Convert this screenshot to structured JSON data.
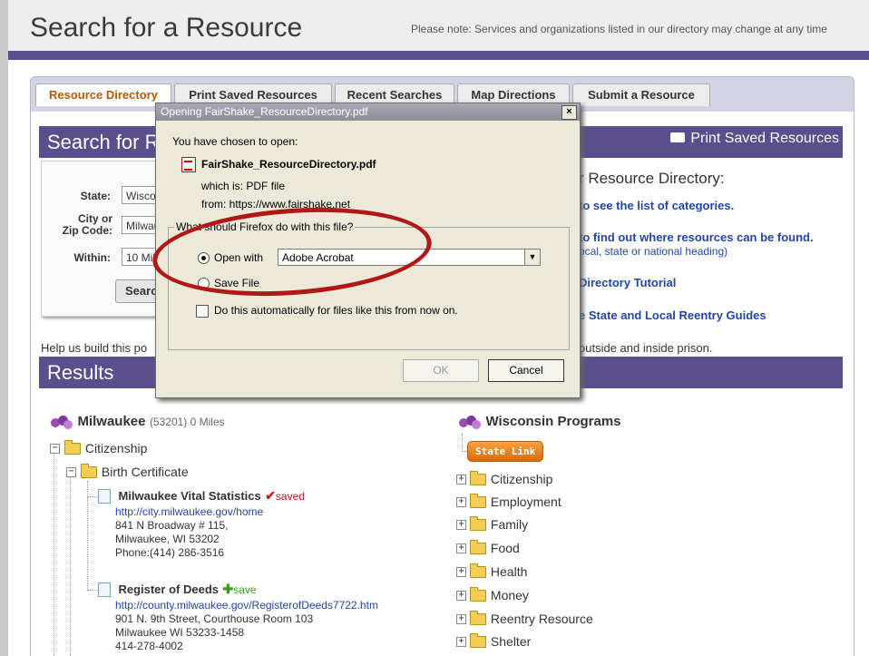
{
  "page": {
    "title": "Search for a Resource",
    "notice": "Please note: Services and organizations listed in our directory may change at any time"
  },
  "tabs": [
    "Resource Directory",
    "Print Saved Resources",
    "Recent Searches",
    "Map Directions",
    "Submit a Resource"
  ],
  "search_section": {
    "header": "Search for R",
    "print_saved": "Print Saved Resources",
    "state_label": "State:",
    "state_value": "Wisconsin",
    "city_label_1": "City or",
    "city_label_2": "Zip Code:",
    "city_value": "Milwaukee",
    "within_label": "Within:",
    "within_value": "10 Miles",
    "search_button": "Search"
  },
  "directory_help": {
    "heading": "r Resource Directory:",
    "link1": "to see the list of categories.",
    "link2": "to find out where resources can be found.",
    "link2_sub": "ocal, state or national heading)",
    "link3": "Directory Tutorial",
    "link4": "e State and Local Reentry Guides"
  },
  "help_line_left": "Help us build this po",
  "help_line_right": "outside and inside prison.",
  "results": {
    "header": "Results",
    "left": {
      "location": "Milwaukee",
      "location_meta": "(53201) 0 Miles",
      "category": "Citizenship",
      "subcategory": "Birth Certificate",
      "items": [
        {
          "name": "Milwaukee Vital Statistics",
          "status": "saved",
          "url": "http://city.milwaukee.gov/home",
          "address1": "841 N Broadway # 115,",
          "address2": "Milwaukee, WI 53202",
          "phone": "Phone:(414) 286-3516"
        },
        {
          "name": "Register of Deeds",
          "status": "save",
          "url": "http://county.milwaukee.gov/RegisterofDeeds7722.htm",
          "address1": "901 N. 9th Street, Courthouse Room 103",
          "address2": "Milwaukee WI 53233-1458",
          "phone": "414-278-4002"
        }
      ]
    },
    "right": {
      "title": "Wisconsin Programs",
      "state_link": "State Link",
      "categories": [
        "Citizenship",
        "Employment",
        "Family",
        "Food",
        "Health",
        "Money",
        "Reentry Resource",
        "Shelter"
      ]
    }
  },
  "dialog": {
    "title": "Opening FairShake_ResourceDirectory.pdf",
    "close": "×",
    "intro": "You have chosen to open:",
    "filename": "FairShake_ResourceDirectory.pdf",
    "which_is": "which is:  PDF file",
    "from": "from:  https://www.fairshake.net",
    "group_label": "What should Firefox do with this file?",
    "open_with_label": "Open with",
    "open_with_value": "Adobe Acrobat",
    "save_file_label": "Save File",
    "auto_label": "Do this automatically for files like this from now on.",
    "ok": "OK",
    "cancel": "Cancel"
  },
  "colors": {
    "brand_purple": "#5b4e8c",
    "link_blue": "#2346a0",
    "active_tab_text": "#b35a00",
    "annotation_red": "#b01717",
    "saved_red": "#d01515",
    "save_green": "#3a9a1a",
    "state_link_orange": "#e07a10"
  }
}
